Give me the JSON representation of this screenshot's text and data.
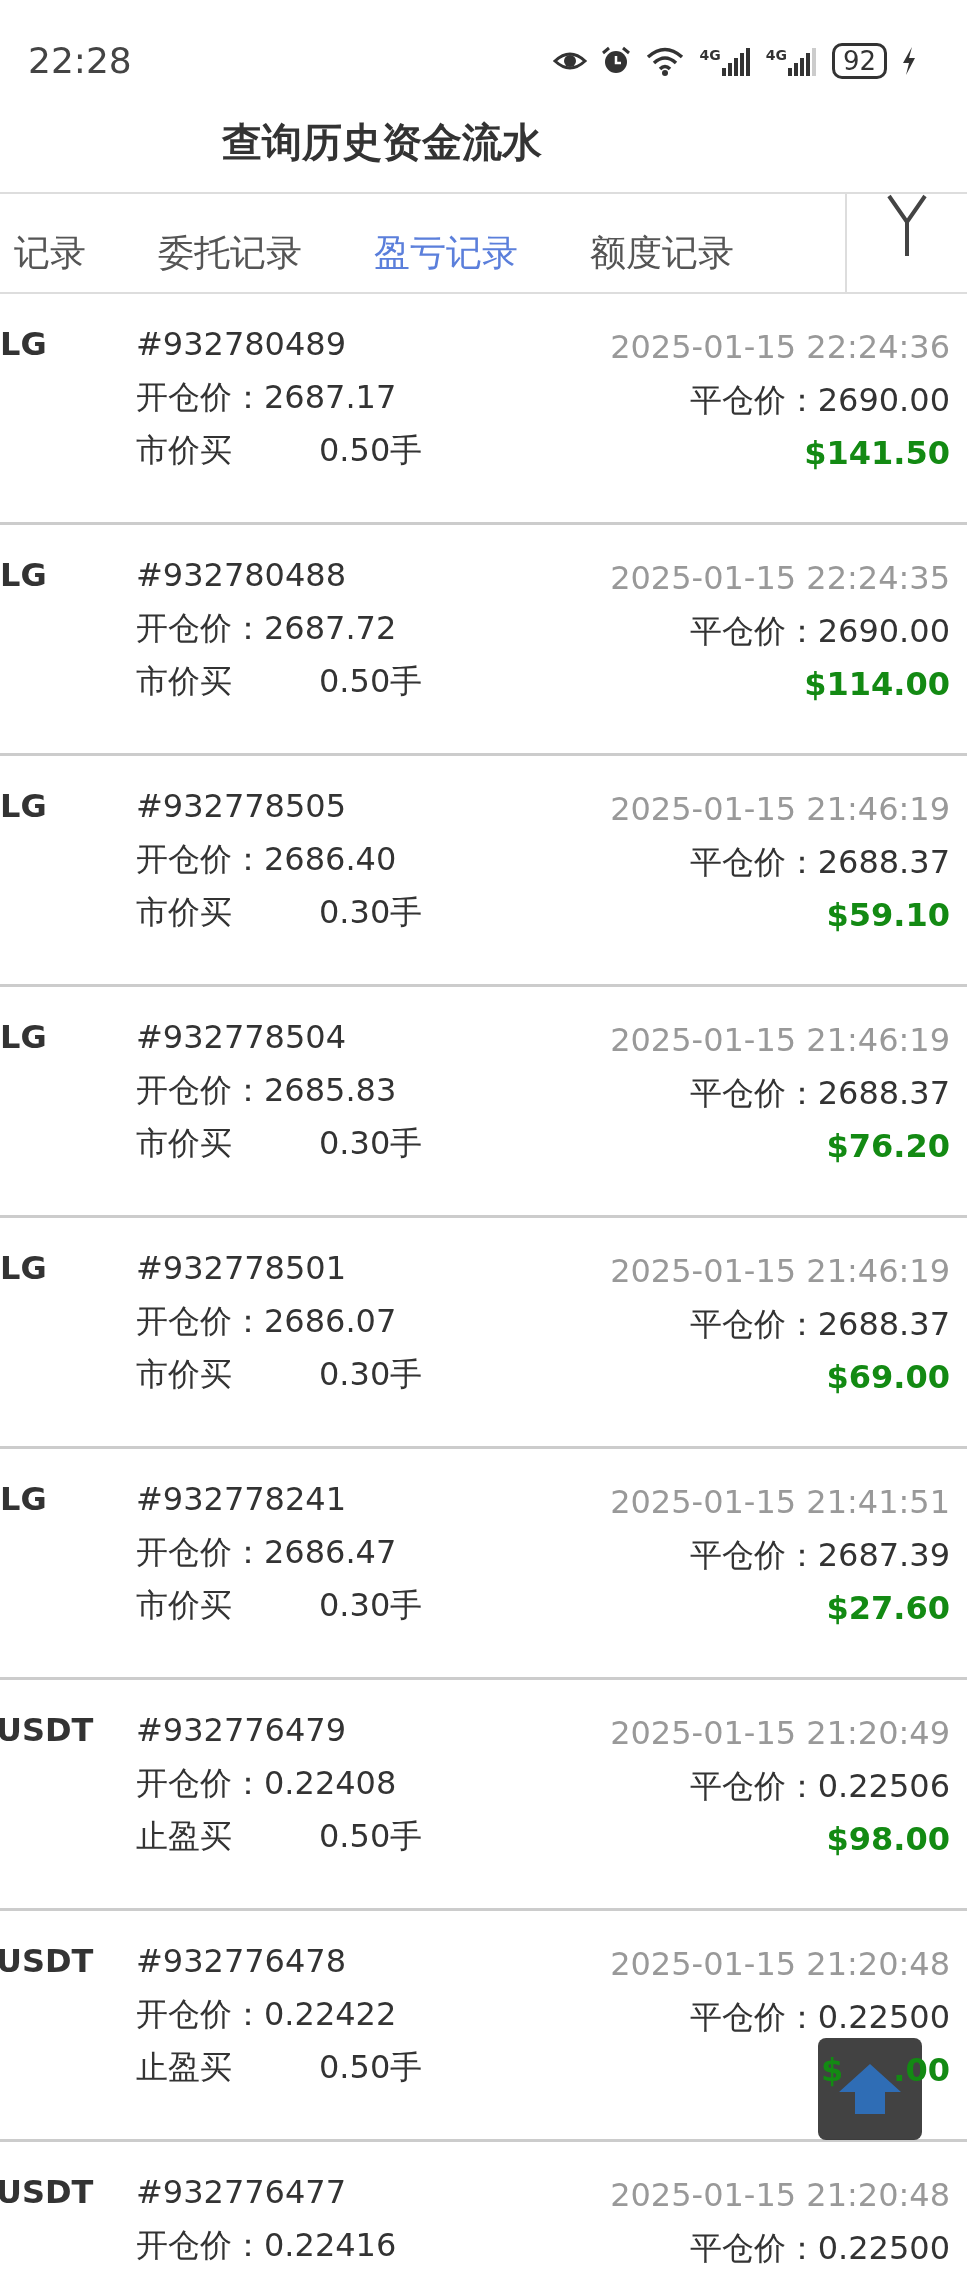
{
  "status_bar": {
    "time": "22:28",
    "network_labels": [
      "4G",
      "4G"
    ],
    "battery": "92",
    "charging": true
  },
  "header": {
    "title": "查询历史资金流水"
  },
  "tabs": [
    {
      "label": "记录",
      "selected": false
    },
    {
      "label": "委托记录",
      "selected": false
    },
    {
      "label": "盈亏记录",
      "selected": true
    },
    {
      "label": "额度记录",
      "selected": false
    }
  ],
  "rows": [
    {
      "symbol": "LG",
      "order_id": "#932780489",
      "time": "2025-01-15 22:24:36",
      "open_price": "开仓价：2687.17",
      "close_price": "平仓价：2690.00",
      "type": "市价买",
      "lots": "0.50手",
      "profit": "$141.50"
    },
    {
      "symbol": "LG",
      "order_id": "#932780488",
      "time": "2025-01-15 22:24:35",
      "open_price": "开仓价：2687.72",
      "close_price": "平仓价：2690.00",
      "type": "市价买",
      "lots": "0.50手",
      "profit": "$114.00"
    },
    {
      "symbol": "LG",
      "order_id": "#932778505",
      "time": "2025-01-15 21:46:19",
      "open_price": "开仓价：2686.40",
      "close_price": "平仓价：2688.37",
      "type": "市价买",
      "lots": "0.30手",
      "profit": "$59.10"
    },
    {
      "symbol": "LG",
      "order_id": "#932778504",
      "time": "2025-01-15 21:46:19",
      "open_price": "开仓价：2685.83",
      "close_price": "平仓价：2688.37",
      "type": "市价买",
      "lots": "0.30手",
      "profit": "$76.20"
    },
    {
      "symbol": "LG",
      "order_id": "#932778501",
      "time": "2025-01-15 21:46:19",
      "open_price": "开仓价：2686.07",
      "close_price": "平仓价：2688.37",
      "type": "市价买",
      "lots": "0.30手",
      "profit": "$69.00"
    },
    {
      "symbol": "LG",
      "order_id": "#932778241",
      "time": "2025-01-15 21:41:51",
      "open_price": "开仓价：2686.47",
      "close_price": "平仓价：2687.39",
      "type": "市价买",
      "lots": "0.30手",
      "profit": "$27.60"
    },
    {
      "symbol": "USDT",
      "order_id": "#932776479",
      "time": "2025-01-15 21:20:49",
      "open_price": "开仓价：0.22408",
      "close_price": "平仓价：0.22506",
      "type": "止盈买",
      "lots": "0.50手",
      "profit": "$98.00"
    },
    {
      "symbol": "USDT",
      "order_id": "#932776478",
      "time": "2025-01-15 21:20:48",
      "open_price": "开仓价：0.22422",
      "close_price": "平仓价：0.22500",
      "type": "止盈买",
      "lots": "0.50手",
      "profit": "$",
      "profit_tail": ".00"
    },
    {
      "symbol": "USDT",
      "order_id": "#932776477",
      "time": "2025-01-15 21:20:48",
      "open_price": "开仓价：0.22416",
      "close_price": "平仓价：0.22500"
    }
  ]
}
